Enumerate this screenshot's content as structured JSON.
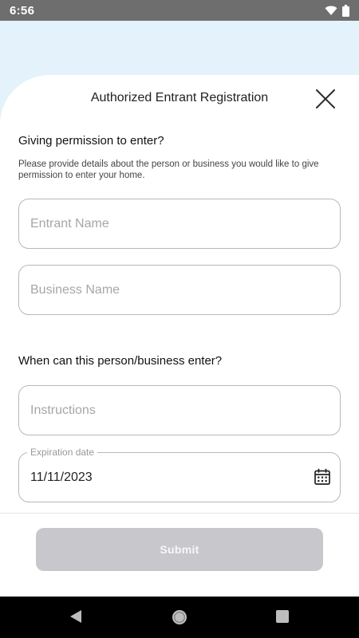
{
  "status_bar": {
    "time": "6:56",
    "icons": [
      "wifi-icon",
      "battery-icon"
    ]
  },
  "header": {
    "title": "Authorized Entrant Registration",
    "close_icon": "close-icon"
  },
  "permission_section": {
    "heading": "Giving permission to enter?",
    "description": "Please provide details about the person or business you would like to give permission to enter your home.",
    "entrant_name": {
      "placeholder": "Entrant Name",
      "value": ""
    },
    "business_name": {
      "placeholder": "Business Name",
      "value": ""
    }
  },
  "when_section": {
    "heading": "When can this person/business enter?",
    "instructions": {
      "placeholder": "Instructions",
      "value": ""
    },
    "expiration": {
      "label": "Expiration date",
      "value": "11/11/2023",
      "icon": "calendar-icon"
    }
  },
  "actions": {
    "submit_label": "Submit",
    "submit_enabled": false
  },
  "nav_bar": {
    "icons": [
      "back-icon",
      "home-icon",
      "recents-icon"
    ]
  },
  "colors": {
    "sky": "#e3f2fb",
    "status_bar": "#6e6e6e",
    "field_border": "#b8b8b8",
    "submit_disabled": "#c8c8cc"
  }
}
